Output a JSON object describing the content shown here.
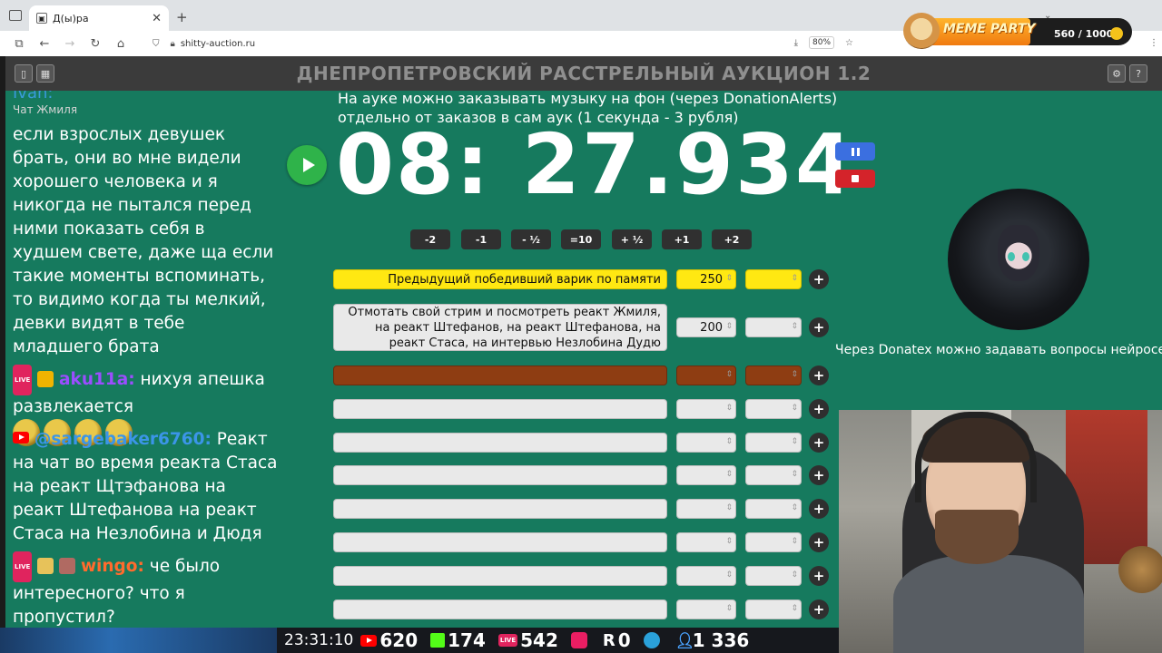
{
  "browser": {
    "tab_title": "Д(ы)ра",
    "tab_close": "✕",
    "new_tab": "+",
    "url": "shitty-auction.ru",
    "zoom": "80%"
  },
  "overlay": {
    "meme_title": "MEME PARTY",
    "meme_score": "560 / 1000"
  },
  "app": {
    "title": "ДНЕПРОПЕТРОВСКИЙ РАССТРЕЛЬНЫЙ АУКЦИОН 1.2",
    "info_line1": "На ауке можно заказывать музыку на фон (через DonationAlerts)",
    "info_line2": "отдельно от заказов в сам аук (1 секунда - 3 рубля)",
    "timer": "08: 27.934",
    "adjust_buttons": [
      "-2",
      "-1",
      "- ½",
      "=10",
      "+ ½",
      "+1",
      "+2"
    ],
    "plus_label": "+",
    "lots": [
      {
        "name": "Предыдущий победивший варик по памяти",
        "amount": "250",
        "color": "#ffe812"
      },
      {
        "name": "Отмотать свой стрим и посмотреть реакт Жмиля, на реакт Штефанов, на реакт Штефанова, на реакт Стаса, на интервью Незлобина Дудю",
        "amount": "200",
        "color": "#e9e9e9"
      },
      {
        "name": "",
        "amount": "",
        "color": "#8e3d12"
      },
      {
        "name": "",
        "amount": ""
      },
      {
        "name": "",
        "amount": ""
      },
      {
        "name": "",
        "amount": ""
      },
      {
        "name": "",
        "amount": ""
      },
      {
        "name": "",
        "amount": ""
      },
      {
        "name": "",
        "amount": ""
      },
      {
        "name": "",
        "amount": ""
      }
    ],
    "donatex_text": "Через Donatex можно задавать вопросы нейросети"
  },
  "chat": {
    "partial_top": "Ivan:",
    "chat_label": "Чат Жмиля",
    "msg1": "если взрослых девушек брать, они во мне видели хорошего человека и я никогда не пытался перед ними показать себя в худшем свете, даже ща если такие моменты вспоминать, то видимо когда ты мелкий, девки видят в тебе младшего брата",
    "msg2_nick": "aku11a:",
    "msg2_text": " нихуя апешка развлекается",
    "msg3_nick": "@sargebaker6760:",
    "msg3_text": " Реакт на чат во время реакта Стаса на реакт Щтэфанова на реакт Штефанова на реакт Стаса на Незлобина и Дюдя",
    "msg4_nick": "wingo:",
    "msg4_text": " че было интересного? что я пропустил?",
    "live_badge": "LIVE"
  },
  "stats": {
    "clock": "23:31:10",
    "youtube": "620",
    "kick": "174",
    "vk": "542",
    "twitch_icon": "twitch-icon",
    "rutube": "0",
    "viewers": "1 336",
    "live_badge": "LIVE",
    "r_glyph": "R"
  },
  "colors": {
    "background": "#167a5e",
    "header": "#3b3b3b",
    "lot_highlight": "#ffe812",
    "lot_brown": "#8e3d12",
    "play": "#2fb34a",
    "pause": "#3b6fe0",
    "stop": "#d4232a"
  }
}
